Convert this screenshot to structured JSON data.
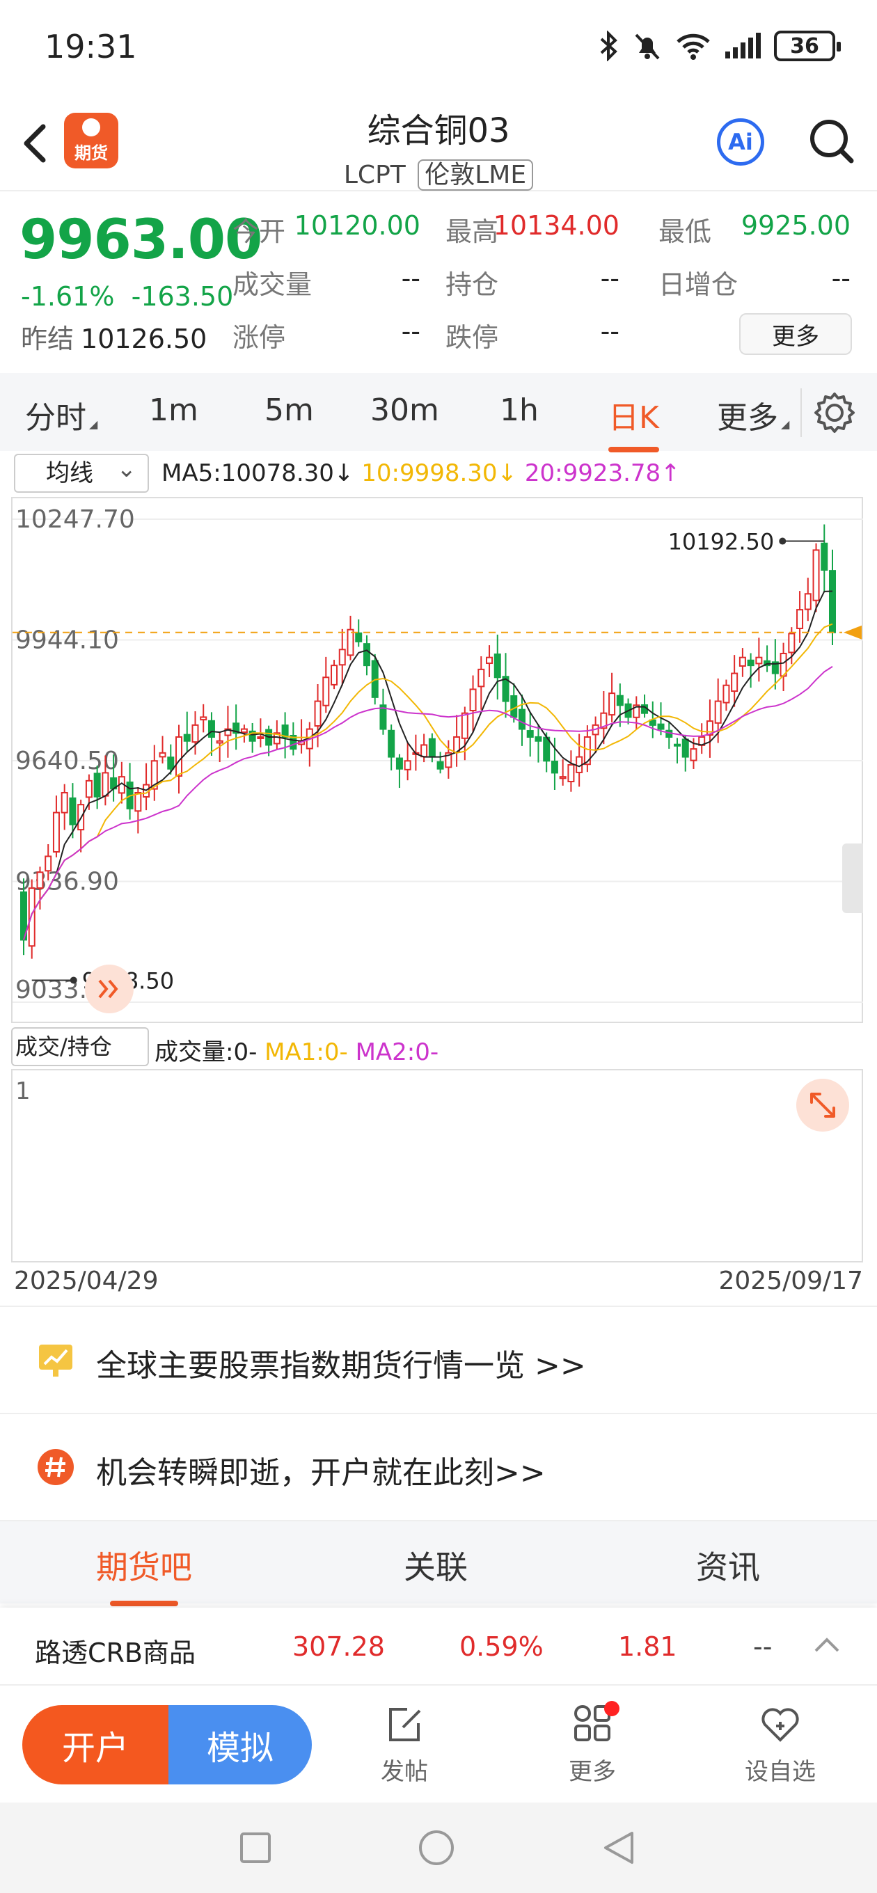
{
  "status_bar": {
    "time": "19:31",
    "battery": "36"
  },
  "header": {
    "title": "综合铜03",
    "code": "LCPT",
    "exchange": "伦敦LME",
    "ai_label": "Ai",
    "logo_text": "期货"
  },
  "quote": {
    "price": "9963.00",
    "change_pct": "-1.61%",
    "change": "-163.50",
    "prev_close_label": "昨结",
    "prev_close": "10126.50",
    "fields": [
      {
        "label": "今开",
        "value": "10120.00",
        "color": "#13a448"
      },
      {
        "label": "最高",
        "value": "10134.00",
        "color": "#e02b2b"
      },
      {
        "label": "最低",
        "value": "9925.00",
        "color": "#13a448"
      },
      {
        "label": "成交量",
        "value": "--",
        "color": "#222222"
      },
      {
        "label": "持仓",
        "value": "--",
        "color": "#222222"
      },
      {
        "label": "日增仓",
        "value": "--",
        "color": "#222222"
      },
      {
        "label": "涨停",
        "value": "--",
        "color": "#222222"
      },
      {
        "label": "跌停",
        "value": "--",
        "color": "#222222"
      }
    ],
    "more_label": "更多"
  },
  "tabs": [
    {
      "label": "分时",
      "active": false
    },
    {
      "label": "1m",
      "active": false
    },
    {
      "label": "5m",
      "active": false
    },
    {
      "label": "30m",
      "active": false
    },
    {
      "label": "1h",
      "active": false
    },
    {
      "label": "日K",
      "active": true
    },
    {
      "label": "更多",
      "active": false
    }
  ],
  "ma_row": {
    "selector": "均线",
    "ma5": "MA5:10078.30↓",
    "ma10": "10:9998.30↓",
    "ma20": "20:9923.78↑",
    "ma10_color": "#f2b705",
    "ma20_color": "#cc33cc"
  },
  "chart_data": {
    "type": "candlestick",
    "y_ticks": [
      "10247.70",
      "9944.10",
      "9640.50",
      "9336.90",
      "9033.30"
    ],
    "ylim": [
      9033.3,
      10247.7
    ],
    "max_label": "10192.50",
    "min_label": "9088.50",
    "last_price": 9963.0,
    "up_color": "#e02b2b",
    "down_color": "#13a448",
    "date_start": "2025/04/29",
    "date_end": "2025/09/17",
    "closes": [
      9190,
      9320,
      9360,
      9400,
      9510,
      9560,
      9480,
      9530,
      9590,
      9550,
      9610,
      9570,
      9600,
      9520,
      9560,
      9580,
      9640,
      9660,
      9620,
      9700,
      9690,
      9730,
      9750,
      9700,
      9690,
      9720,
      9710,
      9720,
      9690,
      9700,
      9680,
      9710,
      9700,
      9670,
      9690,
      9720,
      9790,
      9850,
      9880,
      9920,
      9970,
      9940,
      9880,
      9800,
      9720,
      9650,
      9620,
      9640,
      9660,
      9680,
      9650,
      9620,
      9660,
      9700,
      9760,
      9820,
      9870,
      9900,
      9850,
      9790,
      9750,
      9720,
      9700,
      9690,
      9640,
      9610,
      9600,
      9630,
      9650,
      9700,
      9730,
      9760,
      9810,
      9780,
      9750,
      9780,
      9760,
      9730,
      9720,
      9700,
      9680,
      9650,
      9670,
      9700,
      9740,
      9790,
      9830,
      9860,
      9900,
      9880,
      9900,
      9880,
      9860,
      9910,
      9960,
      10020,
      10060,
      10170,
      10120,
      9963
    ]
  },
  "volume_row": {
    "selector": "成交/持仓",
    "volume": "成交量:0-",
    "ma1": "MA1:0-",
    "ma2": "MA2:0-",
    "axis_label": "1"
  },
  "banners": [
    {
      "text": "全球主要股票指数期货行情一览 >>"
    },
    {
      "text": "机会转瞬即逝，开户就在此刻>>"
    }
  ],
  "sub_tabs": [
    {
      "label": "期货吧",
      "active": true
    },
    {
      "label": "关联",
      "active": false
    },
    {
      "label": "资讯",
      "active": false
    }
  ],
  "ticker": {
    "name": "路透CRB商品",
    "price": "307.28",
    "pct": "0.59%",
    "change": "1.81",
    "extra": "--"
  },
  "bottom_bar": {
    "open_account": "开户",
    "simulate": "模拟",
    "post": "发帖",
    "more": "更多",
    "watchlist": "设自选"
  }
}
